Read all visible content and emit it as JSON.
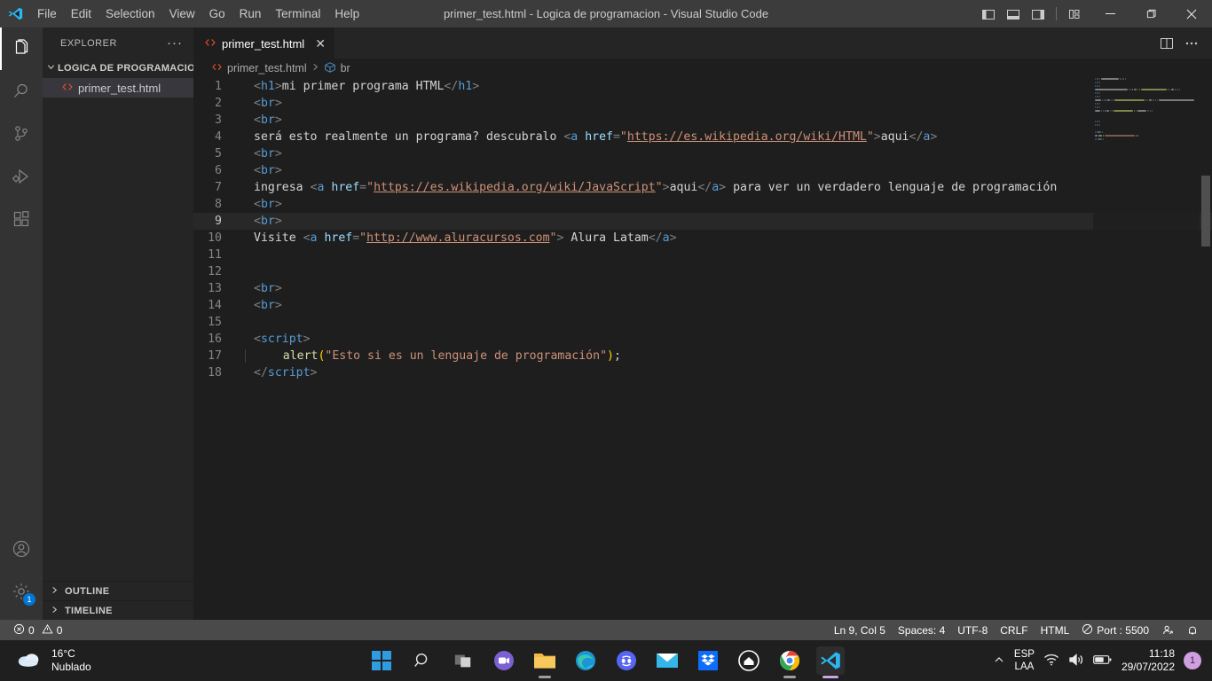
{
  "window": {
    "title": "primer_test.html - Logica de programacion - Visual Studio Code",
    "logo_icon": "vscode-logo-icon",
    "menu": [
      {
        "label": "File"
      },
      {
        "label": "Edit"
      },
      {
        "label": "Selection"
      },
      {
        "label": "View"
      },
      {
        "label": "Go"
      },
      {
        "label": "Run"
      },
      {
        "label": "Terminal"
      },
      {
        "label": "Help"
      }
    ],
    "layout_buttons": [
      {
        "name": "toggle-primary-sidebar-icon"
      },
      {
        "name": "toggle-panel-icon"
      },
      {
        "name": "toggle-secondary-sidebar-icon"
      },
      {
        "name": "customize-layout-icon"
      }
    ],
    "controls": {
      "minimize": "minimize-icon",
      "maximize": "maximize-icon",
      "close": "close-icon"
    }
  },
  "activitybar": {
    "items": [
      {
        "name": "explorer",
        "icon": "files-icon",
        "active": true
      },
      {
        "name": "search",
        "icon": "search-icon",
        "active": false
      },
      {
        "name": "source-control",
        "icon": "source-control-icon",
        "active": false
      },
      {
        "name": "run-and-debug",
        "icon": "run-debug-icon",
        "active": false
      },
      {
        "name": "extensions",
        "icon": "extensions-icon",
        "active": false
      }
    ],
    "bottom": [
      {
        "name": "accounts",
        "icon": "account-icon",
        "badge": null
      },
      {
        "name": "manage",
        "icon": "gear-icon",
        "badge": "1"
      }
    ]
  },
  "sidebar": {
    "title": "EXPLORER",
    "more_actions": "···",
    "folder": {
      "label": "LOGICA DE PROGRAMACION",
      "expanded": true
    },
    "files": [
      {
        "label": "primer_test.html",
        "icon": "html-file-icon",
        "selected": true
      }
    ],
    "sections": [
      {
        "label": "OUTLINE",
        "expanded": false
      },
      {
        "label": "TIMELINE",
        "expanded": false
      }
    ]
  },
  "editor": {
    "tabs": [
      {
        "label": "primer_test.html",
        "icon": "html-file-icon",
        "active": true,
        "close": "✕"
      }
    ],
    "actions": [
      {
        "name": "split-editor-icon"
      },
      {
        "name": "more-actions-icon"
      }
    ],
    "breadcrumb": [
      {
        "label": "primer_test.html",
        "icon": "html-file-icon"
      },
      {
        "label": "br",
        "icon": "symbol-field-icon"
      }
    ],
    "current_line": 9,
    "lines": [
      {
        "n": 1,
        "tokens": [
          {
            "t": "<",
            "c": "t-punct"
          },
          {
            "t": "h1",
            "c": "t-tag"
          },
          {
            "t": ">",
            "c": "t-punct"
          },
          {
            "t": "mi primer programa HTML",
            "c": "t-text"
          },
          {
            "t": "</",
            "c": "t-punct"
          },
          {
            "t": "h1",
            "c": "t-tag"
          },
          {
            "t": ">",
            "c": "t-punct"
          }
        ]
      },
      {
        "n": 2,
        "tokens": [
          {
            "t": "<",
            "c": "t-punct"
          },
          {
            "t": "br",
            "c": "t-tag"
          },
          {
            "t": ">",
            "c": "t-punct"
          }
        ]
      },
      {
        "n": 3,
        "tokens": [
          {
            "t": "<",
            "c": "t-punct"
          },
          {
            "t": "br",
            "c": "t-tag"
          },
          {
            "t": ">",
            "c": "t-punct"
          }
        ]
      },
      {
        "n": 4,
        "tokens": [
          {
            "t": "será esto realmente un programa? descubralo ",
            "c": "t-text"
          },
          {
            "t": "<",
            "c": "t-punct"
          },
          {
            "t": "a",
            "c": "t-tag"
          },
          {
            "t": " ",
            "c": "t-text"
          },
          {
            "t": "href",
            "c": "t-attr"
          },
          {
            "t": "=",
            "c": "t-punct"
          },
          {
            "t": "\"",
            "c": "t-str"
          },
          {
            "t": "https://es.wikipedia.org/wiki/HTML",
            "c": "t-link"
          },
          {
            "t": "\"",
            "c": "t-str"
          },
          {
            "t": ">",
            "c": "t-punct"
          },
          {
            "t": "aqui",
            "c": "t-text"
          },
          {
            "t": "</",
            "c": "t-punct"
          },
          {
            "t": "a",
            "c": "t-tag"
          },
          {
            "t": ">",
            "c": "t-punct"
          }
        ]
      },
      {
        "n": 5,
        "tokens": [
          {
            "t": "<",
            "c": "t-punct"
          },
          {
            "t": "br",
            "c": "t-tag"
          },
          {
            "t": ">",
            "c": "t-punct"
          }
        ]
      },
      {
        "n": 6,
        "tokens": [
          {
            "t": "<",
            "c": "t-punct"
          },
          {
            "t": "br",
            "c": "t-tag"
          },
          {
            "t": ">",
            "c": "t-punct"
          }
        ]
      },
      {
        "n": 7,
        "tokens": [
          {
            "t": "ingresa ",
            "c": "t-text"
          },
          {
            "t": "<",
            "c": "t-punct"
          },
          {
            "t": "a",
            "c": "t-tag"
          },
          {
            "t": " ",
            "c": "t-text"
          },
          {
            "t": "href",
            "c": "t-attr"
          },
          {
            "t": "=",
            "c": "t-punct"
          },
          {
            "t": "\"",
            "c": "t-str"
          },
          {
            "t": "https://es.wikipedia.org/wiki/JavaScript",
            "c": "t-link"
          },
          {
            "t": "\"",
            "c": "t-str"
          },
          {
            "t": ">",
            "c": "t-punct"
          },
          {
            "t": "aqui",
            "c": "t-text"
          },
          {
            "t": "</",
            "c": "t-punct"
          },
          {
            "t": "a",
            "c": "t-tag"
          },
          {
            "t": ">",
            "c": "t-punct"
          },
          {
            "t": " para ver un verdadero lenguaje de programación",
            "c": "t-text"
          }
        ]
      },
      {
        "n": 8,
        "tokens": [
          {
            "t": "<",
            "c": "t-punct"
          },
          {
            "t": "br",
            "c": "t-tag"
          },
          {
            "t": ">",
            "c": "t-punct"
          }
        ]
      },
      {
        "n": 9,
        "tokens": [
          {
            "t": "<",
            "c": "t-punct"
          },
          {
            "t": "br",
            "c": "t-tag"
          },
          {
            "t": ">",
            "c": "t-punct"
          }
        ]
      },
      {
        "n": 10,
        "tokens": [
          {
            "t": "Visite ",
            "c": "t-text"
          },
          {
            "t": "<",
            "c": "t-punct"
          },
          {
            "t": "a",
            "c": "t-tag"
          },
          {
            "t": " ",
            "c": "t-text"
          },
          {
            "t": "href",
            "c": "t-attr"
          },
          {
            "t": "=",
            "c": "t-punct"
          },
          {
            "t": "\"",
            "c": "t-str"
          },
          {
            "t": "http://www.aluracursos.com",
            "c": "t-link"
          },
          {
            "t": "\"",
            "c": "t-str"
          },
          {
            "t": ">",
            "c": "t-punct"
          },
          {
            "t": " Alura Latam",
            "c": "t-text"
          },
          {
            "t": "</",
            "c": "t-punct"
          },
          {
            "t": "a",
            "c": "t-tag"
          },
          {
            "t": ">",
            "c": "t-punct"
          }
        ]
      },
      {
        "n": 11,
        "tokens": []
      },
      {
        "n": 12,
        "tokens": []
      },
      {
        "n": 13,
        "tokens": [
          {
            "t": "<",
            "c": "t-punct"
          },
          {
            "t": "br",
            "c": "t-tag"
          },
          {
            "t": ">",
            "c": "t-punct"
          }
        ]
      },
      {
        "n": 14,
        "tokens": [
          {
            "t": "<",
            "c": "t-punct"
          },
          {
            "t": "br",
            "c": "t-tag"
          },
          {
            "t": ">",
            "c": "t-punct"
          }
        ]
      },
      {
        "n": 15,
        "tokens": []
      },
      {
        "n": 16,
        "tokens": [
          {
            "t": "<",
            "c": "t-punct"
          },
          {
            "t": "script",
            "c": "t-tag"
          },
          {
            "t": ">",
            "c": "t-punct"
          }
        ]
      },
      {
        "n": 17,
        "indent": true,
        "tokens": [
          {
            "t": "    ",
            "c": "t-text"
          },
          {
            "t": "alert",
            "c": "t-fn"
          },
          {
            "t": "(",
            "c": "t-paren"
          },
          {
            "t": "\"Esto si es un lenguaje de programación\"",
            "c": "t-strjs"
          },
          {
            "t": ")",
            "c": "t-paren"
          },
          {
            "t": ";",
            "c": "t-op"
          }
        ]
      },
      {
        "n": 18,
        "tokens": [
          {
            "t": "</",
            "c": "t-punct"
          },
          {
            "t": "script",
            "c": "t-tag"
          },
          {
            "t": ">",
            "c": "t-punct"
          }
        ]
      }
    ]
  },
  "statusbar": {
    "errors": {
      "icon": "error-icon",
      "count": "0"
    },
    "warnings": {
      "icon": "warning-icon",
      "count": "0"
    },
    "right_items": [
      {
        "name": "cursor-position",
        "label": "Ln 9, Col 5"
      },
      {
        "name": "indentation",
        "label": "Spaces: 4"
      },
      {
        "name": "encoding",
        "label": "UTF-8"
      },
      {
        "name": "eol",
        "label": "CRLF"
      },
      {
        "name": "language-mode",
        "label": "HTML"
      },
      {
        "name": "live-server-port",
        "label": "Port : 5500",
        "icon": "circle-slash-icon"
      },
      {
        "name": "feedback",
        "label": "",
        "icon": "feedback-icon"
      },
      {
        "name": "notifications",
        "label": "",
        "icon": "bell-icon"
      }
    ]
  },
  "taskbar": {
    "weather": {
      "temp": "16°C",
      "condition": "Nublado",
      "icon": "cloud-icon"
    },
    "apps": [
      {
        "name": "start",
        "icon": "windows-start-icon"
      },
      {
        "name": "search",
        "icon": "search-icon"
      },
      {
        "name": "task-view",
        "icon": "task-view-icon"
      },
      {
        "name": "teams-chat",
        "icon": "chat-icon"
      },
      {
        "name": "file-explorer",
        "icon": "folder-icon",
        "running": true
      },
      {
        "name": "microsoft-edge",
        "icon": "edge-icon"
      },
      {
        "name": "discord",
        "icon": "discord-icon"
      },
      {
        "name": "mail",
        "icon": "mail-icon"
      },
      {
        "name": "dropbox",
        "icon": "dropbox-icon"
      },
      {
        "name": "onedrive-personal-vault",
        "icon": "home-icon"
      },
      {
        "name": "google-chrome",
        "icon": "chrome-icon",
        "running": true
      },
      {
        "name": "visual-studio-code",
        "icon": "vscode-icon",
        "running": true,
        "active": true
      }
    ],
    "tray": {
      "chevron": "chevron-up-icon",
      "language": {
        "line1": "ESP",
        "line2": "LAA"
      },
      "wifi": "wifi-icon",
      "volume": "volume-icon",
      "battery": "battery-icon",
      "time": "11:18",
      "date": "29/07/2022",
      "notification_count": "1"
    }
  },
  "colors": {
    "titlebar_bg": "#3c3c3c",
    "activitybar_bg": "#333333",
    "sidebar_bg": "#252526",
    "editor_bg": "#1e1e1e",
    "statusbar_bg": "#4a4a4a",
    "taskbar_bg": "#1f1f1f",
    "accent": "#0078d4",
    "html_icon": "#e44d26"
  }
}
